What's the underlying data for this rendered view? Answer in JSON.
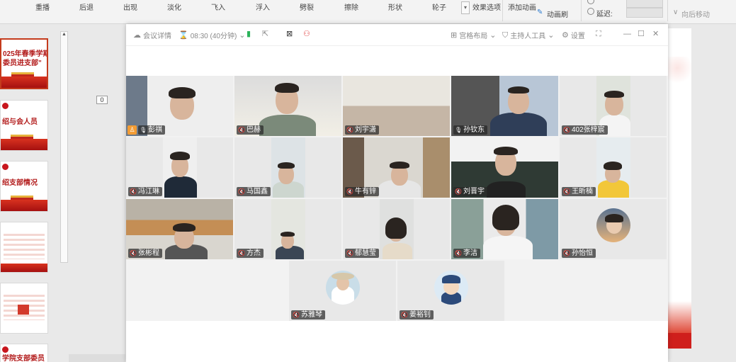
{
  "ribbon": {
    "items": [
      "重播",
      "后退",
      "出现",
      "淡化",
      "飞入",
      "浮入",
      "劈裂",
      "擦除",
      "形状",
      "轮子"
    ],
    "effect_options": "效果选项",
    "add_animation": "添加动画",
    "animation_painter": "动画刷",
    "delay": "延迟:",
    "move_earlier": "向后移动"
  },
  "slide_panel": {
    "thumbnails": [
      {
        "title": "025年春季学期\n委员进支部\""
      },
      {
        "title": "绍与会人员"
      },
      {
        "title": "绍支部情况"
      },
      {
        "title": ""
      },
      {
        "title": ""
      },
      {
        "title": "学院支部委员"
      }
    ],
    "slide_number": "0"
  },
  "meeting": {
    "header": {
      "details": "会议详情",
      "timer": "08:30 (40分钟)",
      "layout": "宫格布局",
      "host_tools": "主持人工具",
      "settings": "设置"
    },
    "participants": [
      {
        "name": "彭祺",
        "host": true
      },
      {
        "name": "巴赫"
      },
      {
        "name": "刘宇潇"
      },
      {
        "name": "孙钦东",
        "speaking": true
      },
      {
        "name": "402张梓宸"
      },
      {
        "name": "冯江琳"
      },
      {
        "name": "马国鑫"
      },
      {
        "name": "牛有锌"
      },
      {
        "name": "刘晋宇"
      },
      {
        "name": "王昕楠"
      },
      {
        "name": "张彬程"
      },
      {
        "name": "方杰"
      },
      {
        "name": "郁慧莹"
      },
      {
        "name": "李洁"
      },
      {
        "name": "孙怡恒"
      },
      {
        "name": "苏雅琴"
      },
      {
        "name": "姜裕钊"
      }
    ]
  },
  "colors": {
    "speaking_border": "#35c07f",
    "host_badge": "#f39c34",
    "party_red": "#c8161d"
  }
}
